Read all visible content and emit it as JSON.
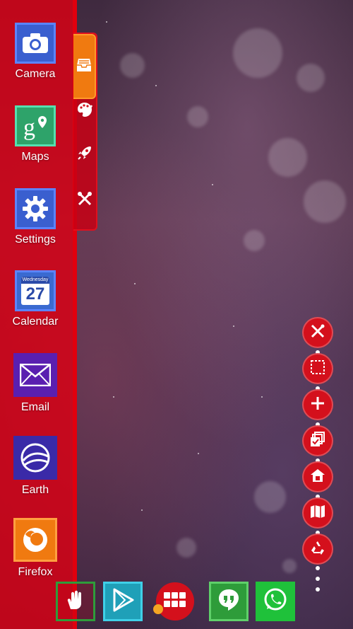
{
  "drawer": {
    "apps": [
      {
        "label": "Camera",
        "icon": "camera-icon",
        "color": "#3a5fcf",
        "border": "#5b84ff"
      },
      {
        "label": "Maps",
        "icon": "google-maps-icon",
        "color": "#2ea36a",
        "border": "#55e0b0"
      },
      {
        "label": "Settings",
        "icon": "gear-icon",
        "color": "#3a5fcf",
        "border": "#5b84ff"
      },
      {
        "label": "Calendar",
        "icon": "calendar-icon",
        "color": "#3a6ad0",
        "border": "#5b84ff",
        "day": "27",
        "weekday": "Wednesday"
      },
      {
        "label": "Email",
        "icon": "envelope-icon",
        "color": "#5a1fb0",
        "border": "#5a1fb0"
      },
      {
        "label": "Earth",
        "icon": "google-earth-icon",
        "color": "#3a2aa8",
        "border": "#3a2aa8"
      },
      {
        "label": "Firefox",
        "icon": "firefox-icon",
        "color": "#f07a10",
        "border": "#ffa040"
      }
    ]
  },
  "side_tabs": [
    "inbox-tray-icon",
    "palette-icon",
    "rocket-icon",
    "tools-icon"
  ],
  "toolbar": [
    "tools-icon",
    "select-area-icon",
    "plus-icon",
    "multi-select-icon",
    "home-icon",
    "map-icon",
    "recycle-icon"
  ],
  "dock": {
    "left_icons": [
      "hand-icon",
      "play-store-icon"
    ],
    "right_icons": [
      "hangouts-icon",
      "whatsapp-icon"
    ],
    "colors": {
      "play_store": "#1fa0b8",
      "hangouts": "#2e9c3a",
      "whatsapp": "#1fc13a",
      "accent": "#d4101c"
    }
  }
}
